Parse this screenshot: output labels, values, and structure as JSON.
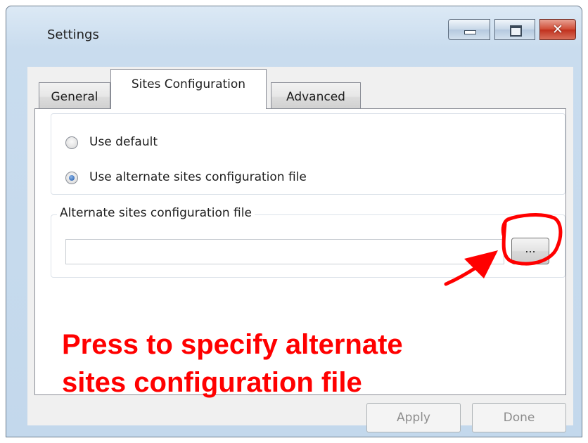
{
  "window": {
    "title": "Settings",
    "controls": {
      "minimize_icon": "minimize-icon",
      "maximize_icon": "maximize-icon",
      "close_icon": "close-icon",
      "close_glyph": "✕"
    }
  },
  "tabs": [
    {
      "label": "General",
      "selected": false
    },
    {
      "label": "Sites Configuration",
      "selected": true
    },
    {
      "label": "Advanced",
      "selected": false
    }
  ],
  "config_mode": {
    "options": [
      {
        "label": "Use default",
        "checked": false
      },
      {
        "label": "Use alternate sites configuration file",
        "checked": true
      }
    ]
  },
  "alternate_file": {
    "group_label": "Alternate sites configuration file",
    "path_value": "",
    "browse_label": "..."
  },
  "annotation": {
    "callout_lines": [
      "Press to specify alternate",
      "sites configuration file"
    ],
    "color": "#ff0000"
  },
  "footer": {
    "apply_label": "Apply",
    "done_label": "Done",
    "apply_enabled": false,
    "done_enabled": false
  }
}
